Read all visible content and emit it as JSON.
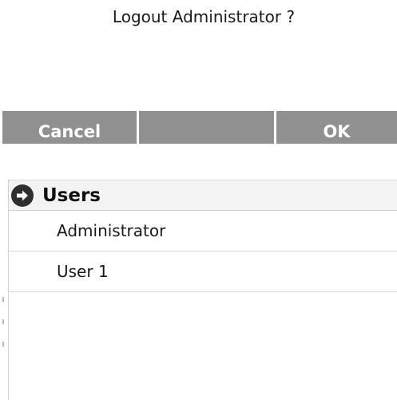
{
  "dialog": {
    "title": "Logout Administrator ?"
  },
  "buttons": {
    "cancel_label": "Cancel",
    "middle_label": "",
    "ok_label": "OK"
  },
  "users": {
    "header_label": "Users",
    "header_icon": "arrow-right-circle-icon",
    "items": [
      {
        "label": "Administrator"
      },
      {
        "label": "User 1"
      }
    ]
  },
  "colors": {
    "button_bar": "#909090",
    "header_background": "#f3f3f3",
    "icon_circle": "#2e2e2e"
  }
}
